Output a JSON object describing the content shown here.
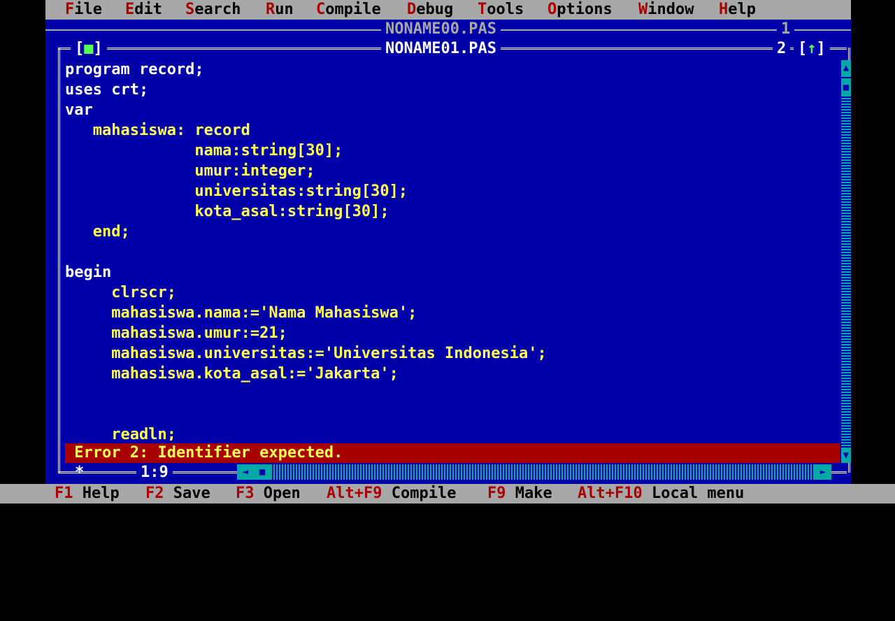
{
  "menu": [
    {
      "hot": "F",
      "rest": "ile"
    },
    {
      "hot": "E",
      "rest": "dit"
    },
    {
      "hot": "S",
      "rest": "earch"
    },
    {
      "hot": "R",
      "rest": "un"
    },
    {
      "hot": "C",
      "rest": "ompile"
    },
    {
      "hot": "D",
      "rest": "ebug"
    },
    {
      "hot": "T",
      "rest": "ools"
    },
    {
      "hot": "O",
      "rest": "ptions"
    },
    {
      "hot": "W",
      "rest": "indow"
    },
    {
      "hot": "H",
      "rest": "elp"
    }
  ],
  "back_window": {
    "title": "NONAME00.PAS",
    "number": "1"
  },
  "window": {
    "title": "NONAME01.PAS",
    "number": "2",
    "close_box": "[■]",
    "zoom_box": "[↑]"
  },
  "code": [
    "program record;",
    "uses crt;",
    "var",
    "   mahasiswa: record",
    "              nama:string[30];",
    "              umur:integer;",
    "              universitas:string[30];",
    "              kota_asal:string[30];",
    "   end;",
    "",
    "begin",
    "     clrscr;",
    "     mahasiswa.nama:='Nama Mahasiswa';",
    "     mahasiswa.umur:=21;",
    "     mahasiswa.universitas:='Universitas Indonesia';",
    "     mahasiswa.kota_asal:='Jakarta';",
    "",
    "",
    "     readln;"
  ],
  "error_message": " Error 2: Identifier expected.",
  "cursor_position": "1:9",
  "resize_glyph": "*",
  "function_keys": [
    {
      "key": "F1",
      "label": " Help"
    },
    {
      "key": "F2",
      "label": " Save"
    },
    {
      "key": "F3",
      "label": " Open"
    },
    {
      "key": "Alt+F9",
      "label": " Compile"
    },
    {
      "key": "F9",
      "label": " Make"
    },
    {
      "key": "Alt+F10",
      "label": " Local menu"
    }
  ],
  "colors": {
    "background": "#0000a8",
    "menu_bg": "#a8a8a8",
    "hotkey": "#a80000",
    "code_text": "#ffff55",
    "error_bg": "#a80000",
    "scrollbar": "#00a8a8"
  }
}
